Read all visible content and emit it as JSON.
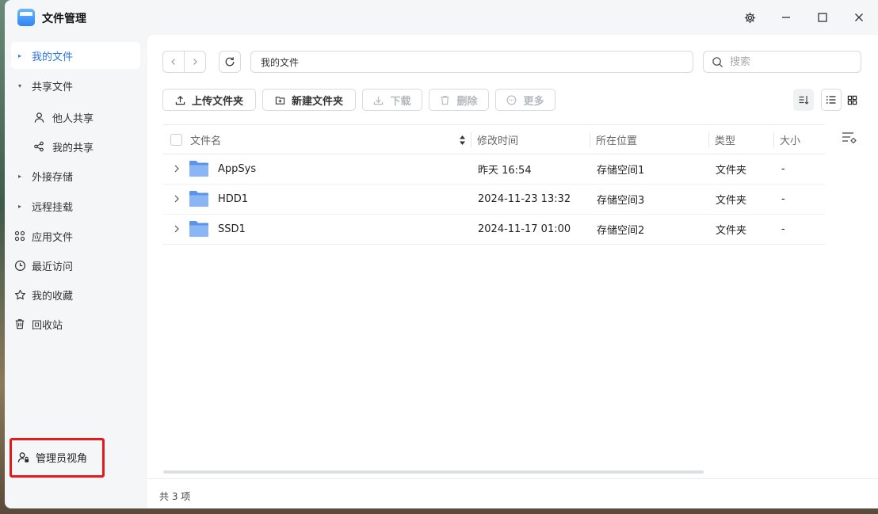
{
  "window": {
    "title": "文件管理",
    "app_icon": "file-manager-app-icon"
  },
  "window_controls": [
    "gear-icon",
    "minimize-icon",
    "maximize-icon",
    "close-icon"
  ],
  "sidebar": {
    "items": [
      {
        "label": "我的文件",
        "icon": "caret-right",
        "active": true
      },
      {
        "label": "共享文件",
        "icon": "caret-down",
        "active": false
      },
      {
        "label": "他人共享",
        "icon": "person-icon",
        "active": false
      },
      {
        "label": "我的共享",
        "icon": "share-icon",
        "active": false
      },
      {
        "label": "外接存储",
        "icon": "caret-right",
        "active": false
      },
      {
        "label": "远程挂载",
        "icon": "caret-right",
        "active": false
      },
      {
        "label": "应用文件",
        "icon": "apps-icon",
        "active": false
      },
      {
        "label": "最近访问",
        "icon": "clock-icon",
        "active": false
      },
      {
        "label": "我的收藏",
        "icon": "star-icon",
        "active": false
      },
      {
        "label": "回收站",
        "icon": "trash-icon",
        "active": false
      }
    ],
    "admin_view": {
      "label": "管理员视角",
      "icon": "admin-user-icon"
    }
  },
  "toolbar": {
    "path": "我的文件",
    "search_placeholder": "搜索",
    "upload_label": "上传文件夹",
    "new_folder_label": "新建文件夹",
    "download_label": "下载",
    "delete_label": "删除",
    "more_label": "更多"
  },
  "table": {
    "columns": [
      "文件名",
      "修改时间",
      "所在位置",
      "类型",
      "大小"
    ],
    "rows": [
      {
        "name": "AppSys",
        "modified": "昨天 16:54",
        "location": "存储空间1",
        "type": "文件夹",
        "size": "-"
      },
      {
        "name": "HDD1",
        "modified": "2024-11-23 13:32",
        "location": "存储空间3",
        "type": "文件夹",
        "size": "-"
      },
      {
        "name": "SSD1",
        "modified": "2024-11-17 01:00",
        "location": "存储空间2",
        "type": "文件夹",
        "size": "-"
      }
    ]
  },
  "status": {
    "count_text": "共 3 项"
  },
  "colors": {
    "accent": "#2a76e8",
    "folder": "#6aa0f0",
    "highlight_border": "#e31b1b"
  }
}
